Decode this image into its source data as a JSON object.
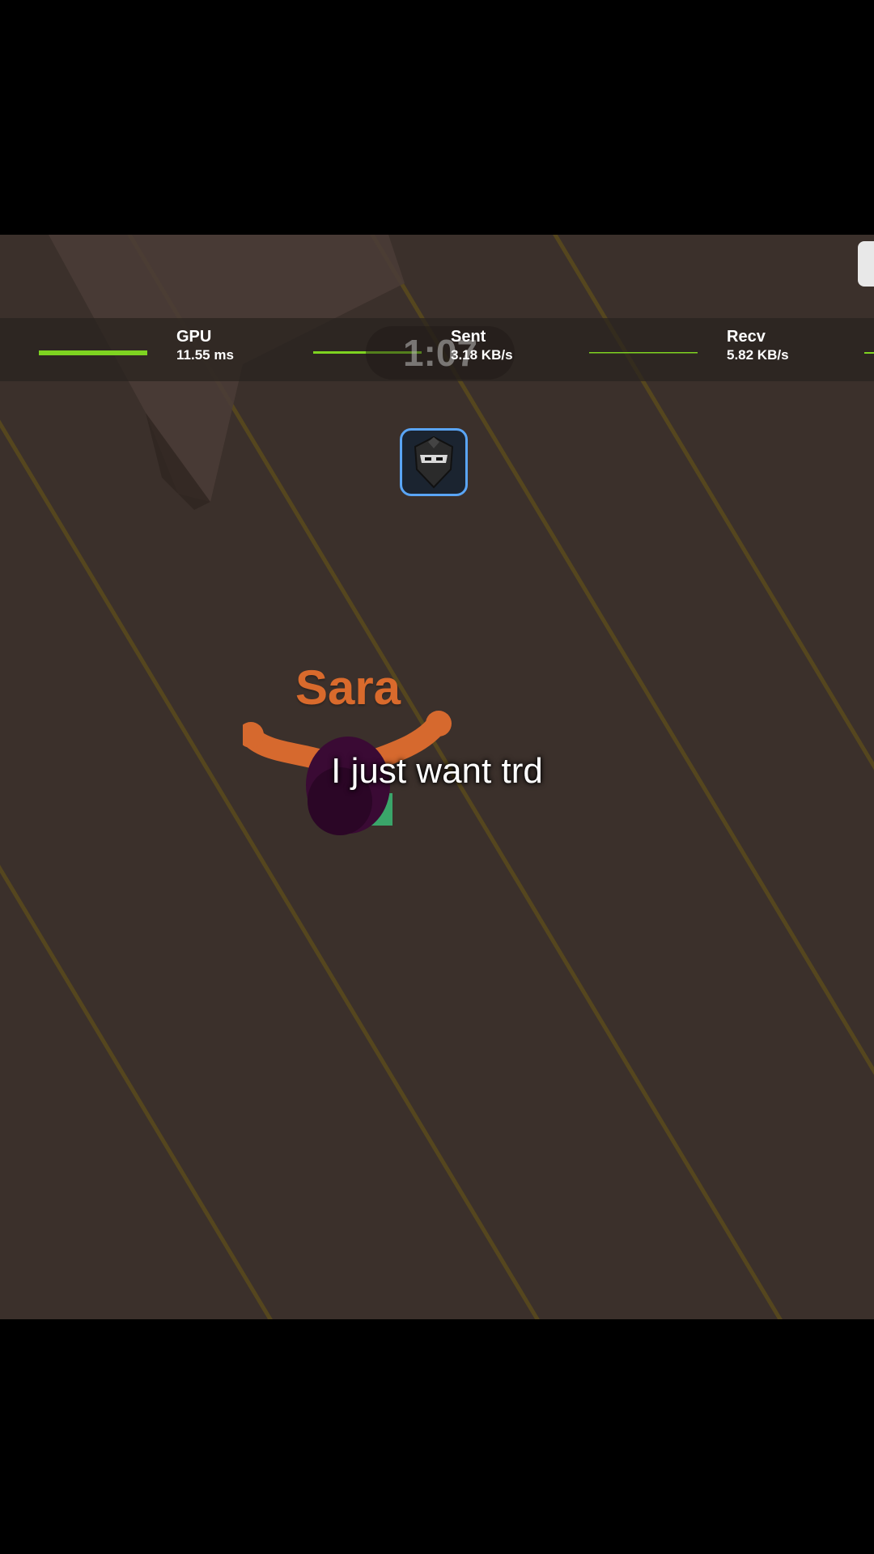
{
  "stats": {
    "gpu": {
      "label": "GPU",
      "value": "11.55 ms"
    },
    "sent": {
      "label": "Sent",
      "value": "3.18 KB/s"
    },
    "recv": {
      "label": "Recv",
      "value": "5.82 KB/s"
    }
  },
  "timer": "1:07",
  "player": {
    "name": "Sara"
  },
  "caption": "I just want trd",
  "colors": {
    "floor": "#3b302b",
    "stripe": "#5a4a1c",
    "graph": "#7ed321",
    "name": "#d96a2c",
    "badge_border": "#5aa5f5"
  },
  "icons": {
    "badge": "ninja-badge-icon",
    "corner": "menu-icon"
  }
}
